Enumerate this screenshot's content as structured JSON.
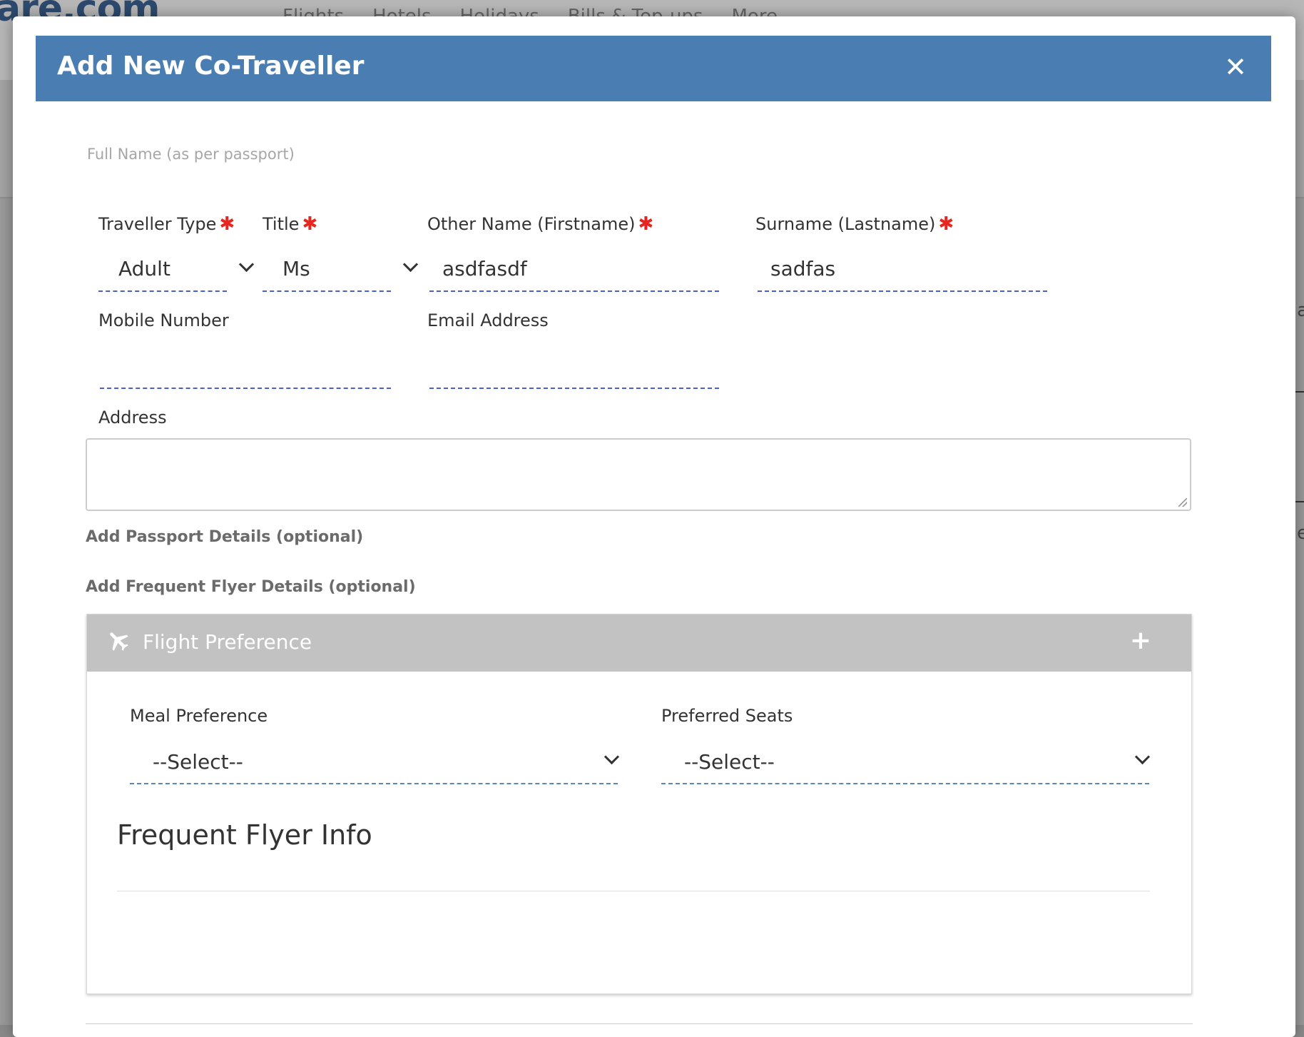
{
  "background": {
    "logo_text": "are.com",
    "nav": [
      "Flights",
      "Hotels",
      "Holidays",
      "Bills & Top-ups",
      "More ..."
    ],
    "right_fragments": [
      "a",
      "e"
    ]
  },
  "modal": {
    "title": "Add New Co-Traveller",
    "close_icon": "✕",
    "section_hint": "Full Name (as per passport)",
    "required_marker": "✱",
    "fields": {
      "traveller_type": {
        "label": "Traveller Type",
        "value": "Adult"
      },
      "title": {
        "label": "Title",
        "value": "Ms"
      },
      "first_name": {
        "label": "Other Name (Firstname)",
        "value": "asdfasdf"
      },
      "last_name": {
        "label": "Surname (Lastname)",
        "value": "sadfas"
      },
      "mobile": {
        "label": "Mobile Number",
        "value": ""
      },
      "email": {
        "label": "Email Address",
        "value": ""
      },
      "address": {
        "label": "Address",
        "value": ""
      }
    },
    "links": {
      "passport": "Add Passport Details (optional)",
      "frequent_flyer": "Add Frequent Flyer Details (optional)"
    },
    "flight_preference": {
      "title": "Flight Preference",
      "expand_icon": "+",
      "meal": {
        "label": "Meal Preference",
        "value": "--Select--"
      },
      "seats": {
        "label": "Preferred Seats",
        "value": "--Select--"
      },
      "frequent_flyer_title": "Frequent Flyer Info"
    }
  },
  "colors": {
    "header_blue": "#4a7db2",
    "required_red": "#e8261f",
    "panel_header_gray": "#c2c2c2",
    "underline_blue": "#4a5fc8"
  }
}
